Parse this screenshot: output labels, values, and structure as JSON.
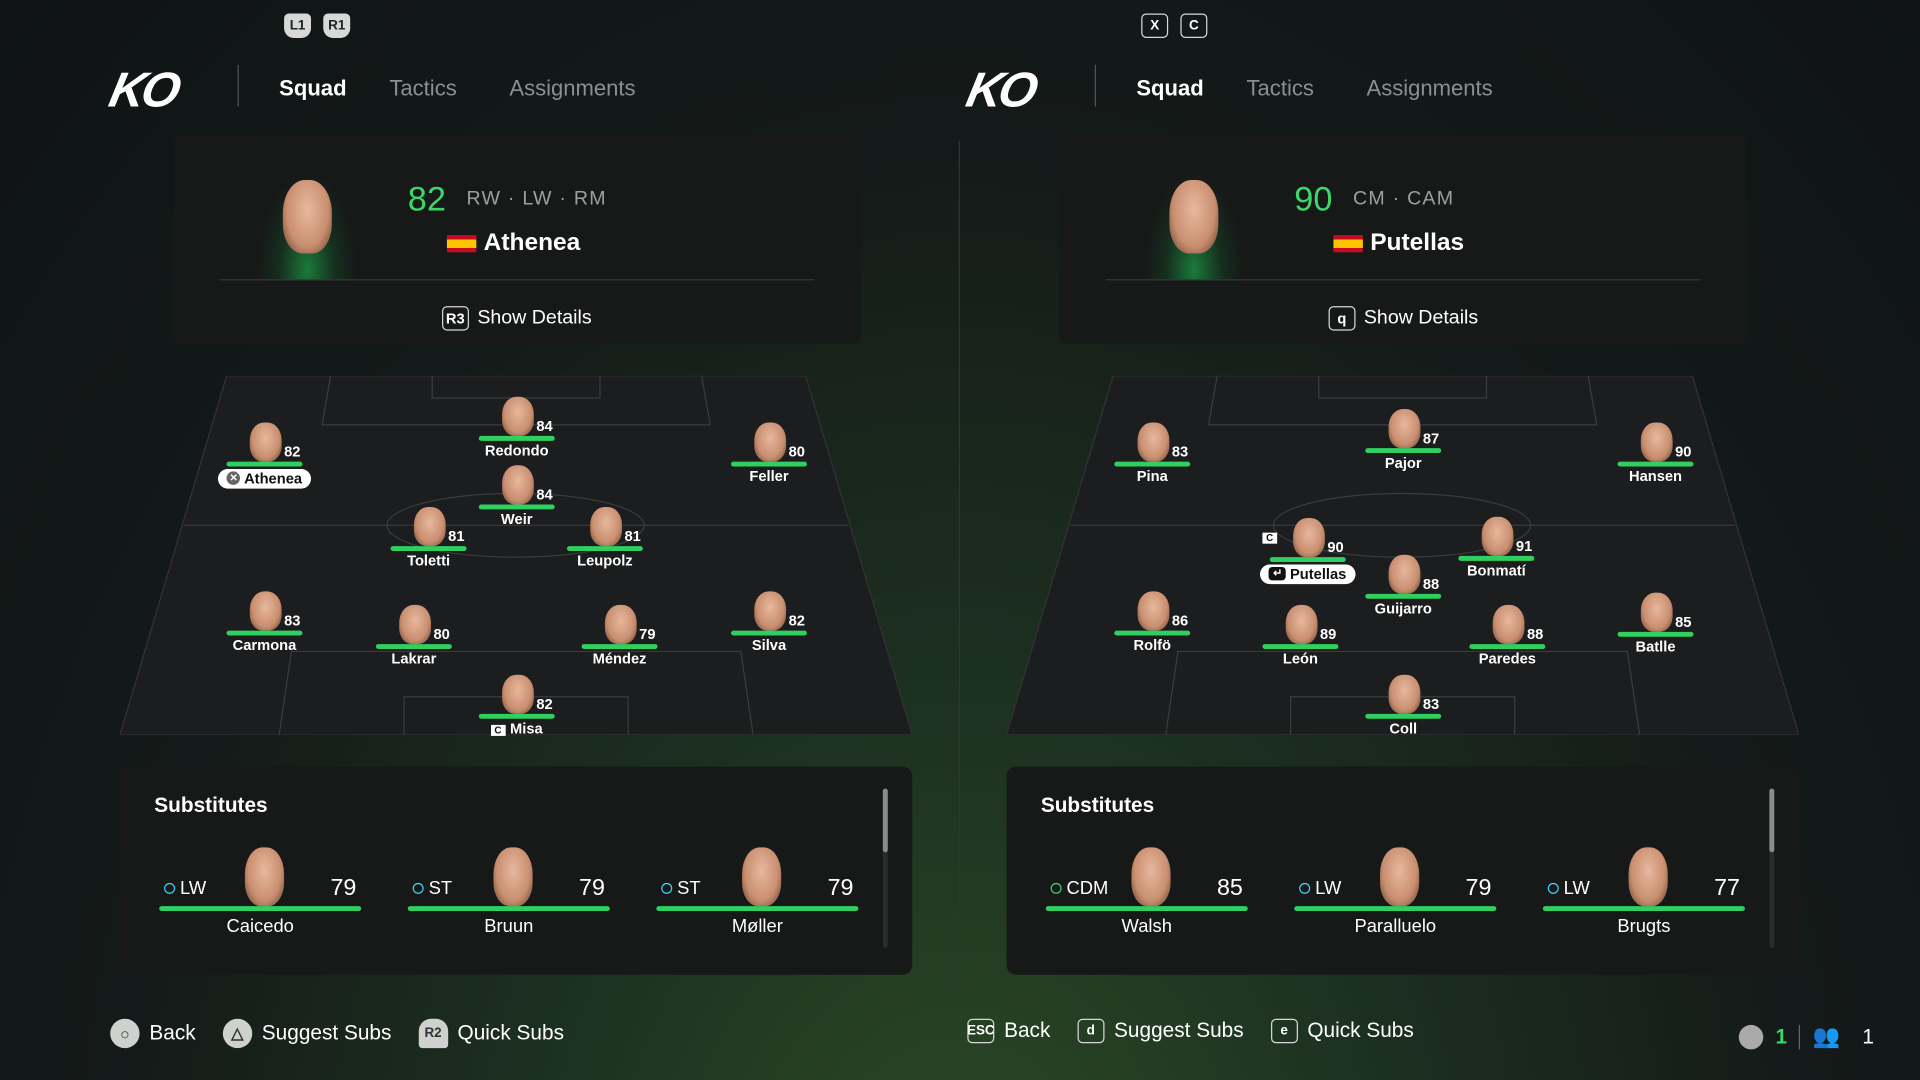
{
  "colors": {
    "accent": "#3dd66b",
    "bar": "#2fd060"
  },
  "panels": [
    {
      "bumpers": [
        "L1",
        "R1"
      ],
      "bumper_style": "controller",
      "logo": "KO",
      "tabs": [
        "Squad",
        "Tactics",
        "Assignments"
      ],
      "active_tab": "Squad",
      "selected": {
        "rating": "82",
        "positions": "RW · LW · RM",
        "name": "Athenea",
        "flag": "spain-flag",
        "details_key": "R3",
        "details_label": "Show Details"
      },
      "players": [
        {
          "name": "Athenea",
          "rating": "82",
          "selected": true
        },
        {
          "name": "Redondo",
          "rating": "84"
        },
        {
          "name": "Feller",
          "rating": "80"
        },
        {
          "name": "Weir",
          "rating": "84"
        },
        {
          "name": "Toletti",
          "rating": "81"
        },
        {
          "name": "Leupolz",
          "rating": "81"
        },
        {
          "name": "Carmona",
          "rating": "83"
        },
        {
          "name": "Lakrar",
          "rating": "80"
        },
        {
          "name": "Méndez",
          "rating": "79"
        },
        {
          "name": "Silva",
          "rating": "82"
        },
        {
          "name": "Misa",
          "rating": "82",
          "captain": "C"
        }
      ],
      "subs_title": "Substitutes",
      "subs": [
        {
          "pos": "LW",
          "rating": "79",
          "name": "Caicedo"
        },
        {
          "pos": "ST",
          "rating": "79",
          "name": "Bruun"
        },
        {
          "pos": "ST",
          "rating": "79",
          "name": "Møller"
        }
      ],
      "footer": [
        {
          "key": "○",
          "label": "Back"
        },
        {
          "key": "△",
          "label": "Suggest Subs"
        },
        {
          "key": "R2",
          "label": "Quick Subs"
        }
      ]
    },
    {
      "bumpers": [
        "X",
        "C"
      ],
      "bumper_style": "keyboard",
      "logo": "KO",
      "tabs": [
        "Squad",
        "Tactics",
        "Assignments"
      ],
      "active_tab": "Squad",
      "selected": {
        "rating": "90",
        "positions": "CM · CAM",
        "name": "Putellas",
        "flag": "spain-flag",
        "details_key": "q",
        "details_label": "Show Details"
      },
      "players": [
        {
          "name": "Pina",
          "rating": "83"
        },
        {
          "name": "Pajor",
          "rating": "87"
        },
        {
          "name": "Hansen",
          "rating": "90"
        },
        {
          "name": "Putellas",
          "rating": "90",
          "selected": true,
          "captain": "C"
        },
        {
          "name": "Bonmatí",
          "rating": "91"
        },
        {
          "name": "Guijarro",
          "rating": "88"
        },
        {
          "name": "Rolfö",
          "rating": "86"
        },
        {
          "name": "León",
          "rating": "89"
        },
        {
          "name": "Paredes",
          "rating": "88"
        },
        {
          "name": "Batlle",
          "rating": "85"
        },
        {
          "name": "Coll",
          "rating": "83"
        }
      ],
      "subs_title": "Substitutes",
      "subs": [
        {
          "pos": "CDM",
          "rating": "85",
          "name": "Walsh"
        },
        {
          "pos": "LW",
          "rating": "79",
          "name": "Paralluelo"
        },
        {
          "pos": "LW",
          "rating": "77",
          "name": "Brugts"
        }
      ],
      "footer": [
        {
          "key": "ESC",
          "label": "Back"
        },
        {
          "key": "d",
          "label": "Suggest Subs"
        },
        {
          "key": "e",
          "label": "Quick Subs"
        }
      ]
    }
  ],
  "status": {
    "voice_icon": "speaker-icon",
    "voice_count": "1",
    "players_icon": "users-icon",
    "players_count": "1"
  }
}
